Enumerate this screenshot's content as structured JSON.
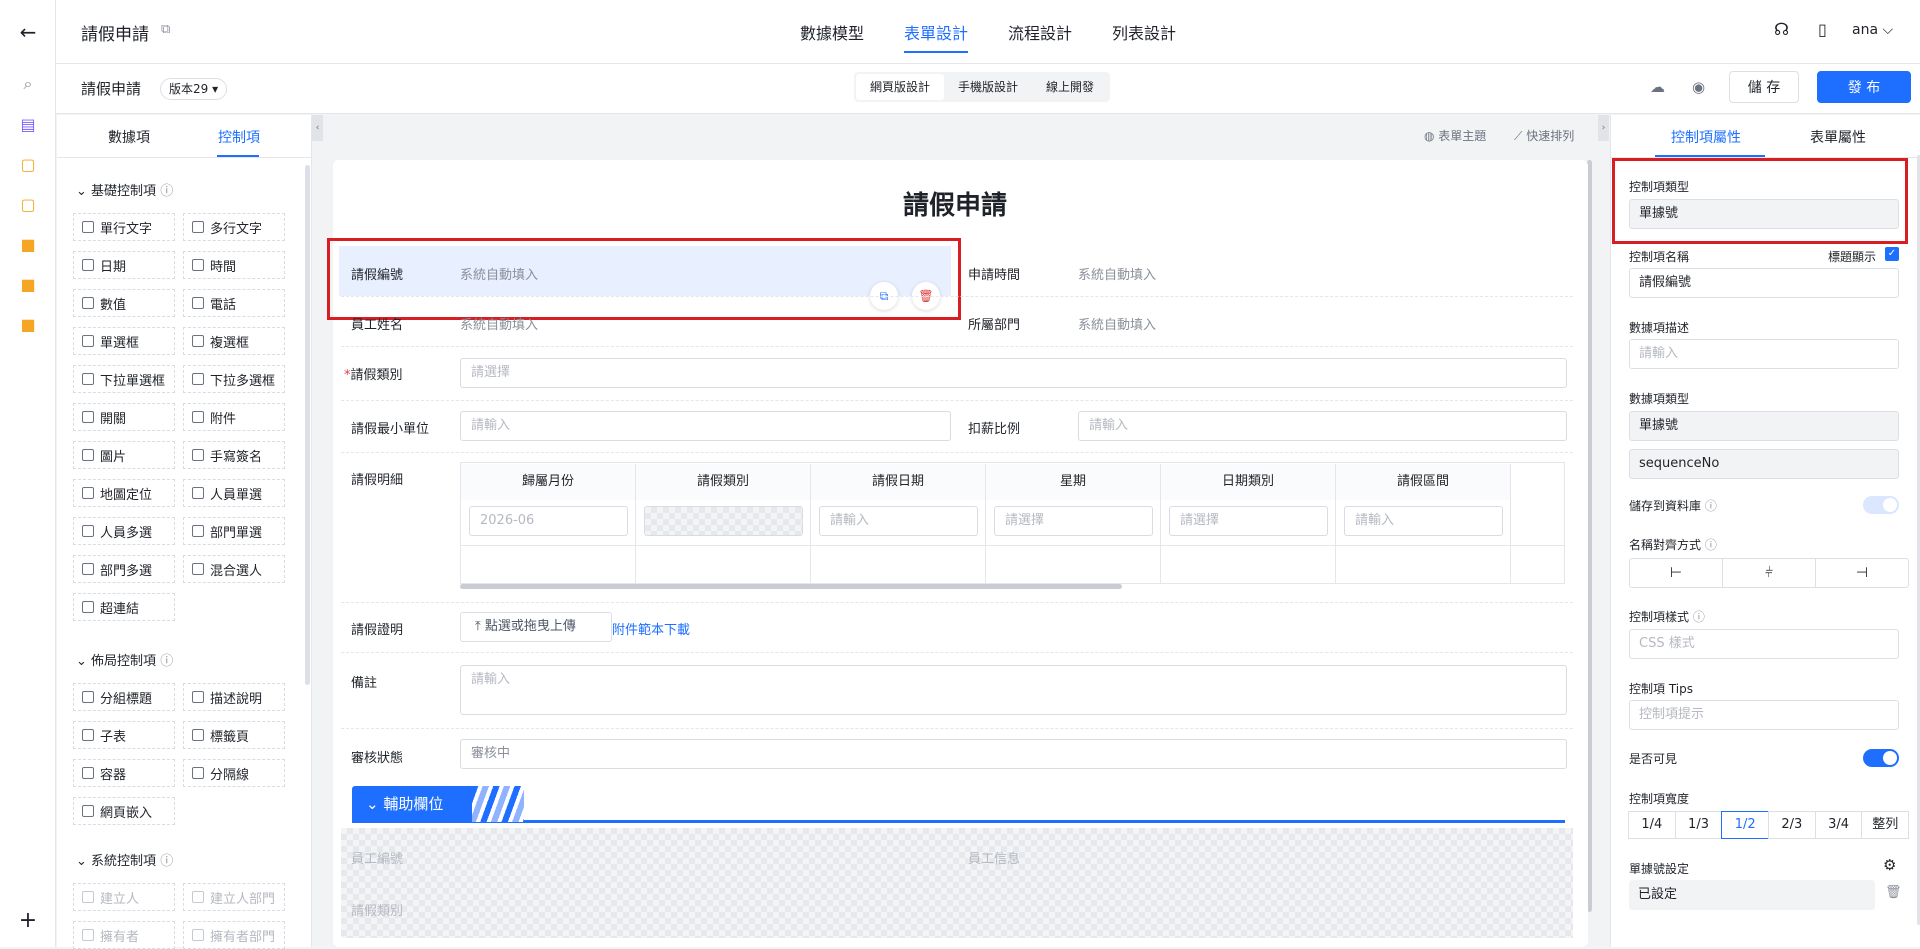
{
  "app": {
    "title": "請假申請",
    "user": "ana"
  },
  "nav_tabs": [
    "數據模型",
    "表單設計",
    "流程設計",
    "列表設計"
  ],
  "sub": {
    "form_name": "請假申請",
    "version": "版本29",
    "modes": [
      "網頁版設計",
      "手機版設計",
      "線上開發"
    ],
    "save": "儲 存",
    "publish": "發 布"
  },
  "left": {
    "tabs": [
      "數據項",
      "控制項"
    ],
    "sections": [
      {
        "title": "基礎控制項",
        "items": [
          "單行文字",
          "多行文字",
          "日期",
          "時間",
          "數值",
          "電話",
          "單選框",
          "複選框",
          "下拉單選框",
          "下拉多選框",
          "開關",
          "附件",
          "圖片",
          "手寫簽名",
          "地圖定位",
          "人員單選",
          "人員多選",
          "部門單選",
          "部門多選",
          "混合選人",
          "超連結"
        ]
      },
      {
        "title": "佈局控制項",
        "items": [
          "分組標題",
          "描述說明",
          "子表",
          "標籤頁",
          "容器",
          "分隔線",
          "網頁嵌入"
        ]
      },
      {
        "title": "系統控制項",
        "items": [
          "建立人",
          "建立人部門",
          "擁有者",
          "擁有者部門"
        ]
      }
    ]
  },
  "canvas": {
    "theme": "表單主題",
    "arrange": "快速排列"
  },
  "form": {
    "title": "請假申請",
    "f1": {
      "label": "請假編號",
      "value": "系統自動填入"
    },
    "f2": {
      "label": "申請時間",
      "value": "系統自動填入"
    },
    "f3": {
      "label": "員工姓名",
      "value": "系統自動填入"
    },
    "f4": {
      "label": "所屬部門",
      "value": "系統自動填入"
    },
    "f5": {
      "label": "請假類別",
      "placeholder": "請選擇",
      "required": "*"
    },
    "f6": {
      "label": "請假最小單位",
      "placeholder": "請輸入"
    },
    "f7": {
      "label": "扣薪比例",
      "placeholder": "請輸入"
    },
    "detail": {
      "label": "請假明細",
      "columns": [
        "歸屬月份",
        "請假類別",
        "請假日期",
        "星期",
        "日期類別",
        "請假區間"
      ],
      "row": [
        "2026-06",
        "",
        "請輸入",
        "請選擇",
        "請選擇",
        "請輸入"
      ]
    },
    "f8": {
      "label": "請假證明",
      "upload": "點選或拖曳上傳",
      "link": "附件範本下載"
    },
    "f9": {
      "label": "備註",
      "placeholder": "請輸入"
    },
    "f10": {
      "label": "審核狀態",
      "value": "審核中"
    },
    "aux": {
      "title": "輔助欄位",
      "r1a": "員工編號",
      "r1b": "員工信息",
      "r2a": "請假類別"
    }
  },
  "right": {
    "tabs": [
      "控制項屬性",
      "表單屬性"
    ],
    "ctl_type": {
      "label": "控制項類型",
      "value": "單據號"
    },
    "ctl_name": {
      "label": "控制項名稱",
      "show_title": "標題顯示",
      "value": "請假編號"
    },
    "desc": {
      "label": "數據項描述",
      "placeholder": "請輸入"
    },
    "data_type": {
      "label": "數據項類型",
      "value": "單據號",
      "code": "sequenceNo"
    },
    "store": "儲存到資料庫",
    "align": "名稱對齊方式",
    "style": {
      "label": "控制項樣式",
      "placeholder": "CSS 樣式"
    },
    "tips": {
      "label": "控制項 Tips",
      "placeholder": "控制項提示"
    },
    "visible": "是否可見",
    "width": {
      "label": "控制項寬度",
      "options": [
        "1/4",
        "1/3",
        "1/2",
        "2/3",
        "3/4",
        "整列"
      ],
      "selected": "1/2"
    },
    "seq": {
      "label": "單據號設定",
      "value": "已設定"
    }
  }
}
